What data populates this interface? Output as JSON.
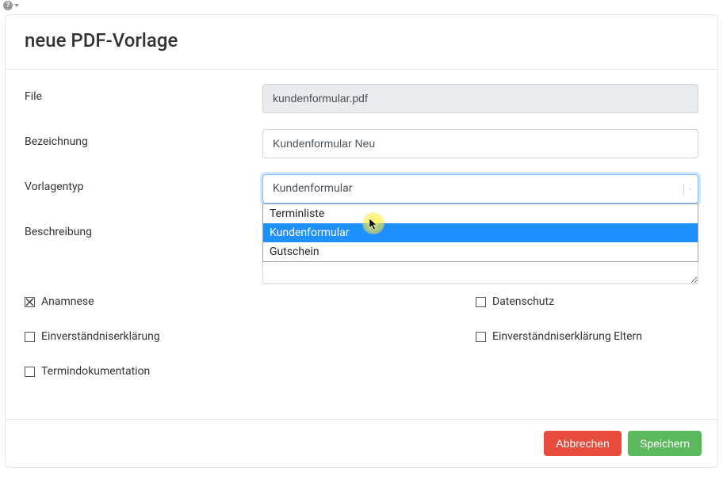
{
  "header": {
    "title": "neue PDF-Vorlage"
  },
  "form": {
    "file_label": "File",
    "file_value": "kundenformular.pdf",
    "name_label": "Bezeichnung",
    "name_value": "Kundenformular Neu",
    "type_label": "Vorlagentyp",
    "type_selected": "Kundenformular",
    "type_options": [
      "Terminliste",
      "Kundenformular",
      "Gutschein"
    ],
    "type_highlighted_index": 1,
    "description_label": "Beschreibung",
    "description_value": ""
  },
  "checkboxes": [
    {
      "label": "Anamnese",
      "checked": true
    },
    {
      "label": "Datenschutz",
      "checked": false
    },
    {
      "label": "Einverständniserklärung",
      "checked": false
    },
    {
      "label": "Einverständniserklärung Eltern",
      "checked": false
    },
    {
      "label": "Termindokumentation",
      "checked": false
    }
  ],
  "buttons": {
    "cancel": "Abbrechen",
    "save": "Speichern"
  }
}
